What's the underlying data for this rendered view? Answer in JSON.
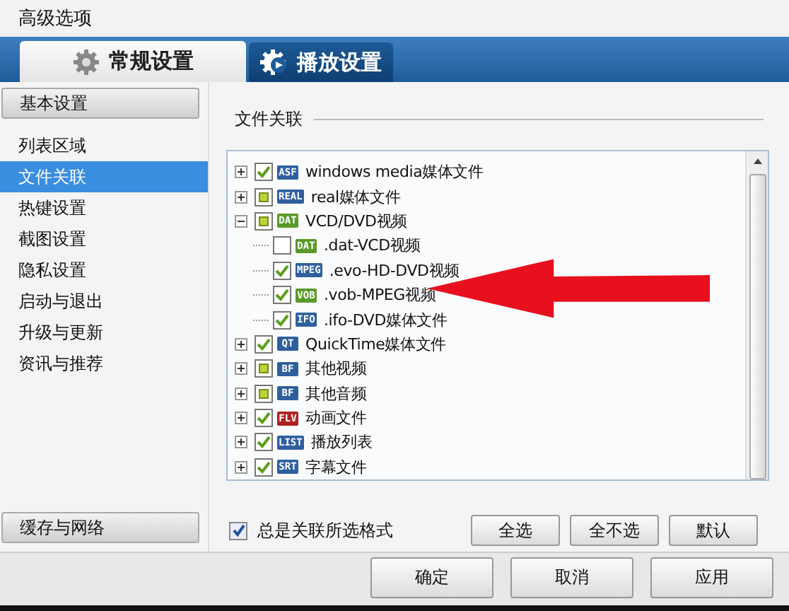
{
  "window": {
    "title": "高级选项"
  },
  "tabs": [
    {
      "label": "常规设置",
      "selected": true
    },
    {
      "label": "播放设置",
      "selected": false
    }
  ],
  "sidebar": {
    "items": [
      {
        "label": "基本设置",
        "kind": "header",
        "selected": false
      },
      {
        "label": "列表区域",
        "kind": "item",
        "selected": false
      },
      {
        "label": "文件关联",
        "kind": "item",
        "selected": true
      },
      {
        "label": "热键设置",
        "kind": "item",
        "selected": false
      },
      {
        "label": "截图设置",
        "kind": "item",
        "selected": false
      },
      {
        "label": "隐私设置",
        "kind": "item",
        "selected": false
      },
      {
        "label": "启动与退出",
        "kind": "item",
        "selected": false
      },
      {
        "label": "升级与更新",
        "kind": "item",
        "selected": false
      },
      {
        "label": "资讯与推荐",
        "kind": "item",
        "selected": false
      }
    ],
    "footer": {
      "label": "缓存与网络"
    }
  },
  "group": {
    "title": "文件关联"
  },
  "tree": [
    {
      "label": "windows media媒体文件",
      "badge": "ASF",
      "color": "#2f5f9e",
      "checked": true,
      "partial": false,
      "expanded": false
    },
    {
      "label": "real媒体文件",
      "badge": "REAL",
      "color": "#2f5f9e",
      "checked": false,
      "partial": true,
      "expanded": false
    },
    {
      "label": "VCD/DVD视频",
      "badge": "DAT",
      "color": "#5a9a2a",
      "checked": false,
      "partial": true,
      "expanded": true,
      "children": [
        {
          "label": ".dat-VCD视频",
          "badge": "DAT",
          "color": "#5a9a2a",
          "checked": false,
          "partial": false
        },
        {
          "label": ".evo-HD-DVD视频",
          "badge": "MPEG",
          "color": "#2f5f9e",
          "checked": true,
          "partial": false
        },
        {
          "label": ".vob-MPEG视频",
          "badge": "VOB",
          "color": "#5a9a2a",
          "checked": true,
          "partial": false
        },
        {
          "label": ".ifo-DVD媒体文件",
          "badge": "IFO",
          "color": "#2f5f9e",
          "checked": true,
          "partial": false
        }
      ]
    },
    {
      "label": "QuickTime媒体文件",
      "badge": "QT",
      "color": "#2f5f9e",
      "checked": true,
      "partial": false,
      "expanded": false
    },
    {
      "label": "其他视频",
      "badge": "BF",
      "color": "#2f5f9e",
      "checked": false,
      "partial": true,
      "expanded": false
    },
    {
      "label": "其他音频",
      "badge": "BF",
      "color": "#2f5f9e",
      "checked": false,
      "partial": true,
      "expanded": false
    },
    {
      "label": "动画文件",
      "badge": "FLV",
      "color": "#b02020",
      "checked": true,
      "partial": false,
      "expanded": false
    },
    {
      "label": "播放列表",
      "badge": "LIST",
      "color": "#2f5f9e",
      "checked": true,
      "partial": false,
      "expanded": false
    },
    {
      "label": "字幕文件",
      "badge": "SRT",
      "color": "#2f5f9e",
      "checked": true,
      "partial": false,
      "expanded": false
    }
  ],
  "always_associate": {
    "label": "总是关联所选格式",
    "checked": true
  },
  "select_buttons": [
    "全选",
    "全不选",
    "默认"
  ],
  "dialog_buttons": [
    "确定",
    "取消",
    "应用"
  ]
}
